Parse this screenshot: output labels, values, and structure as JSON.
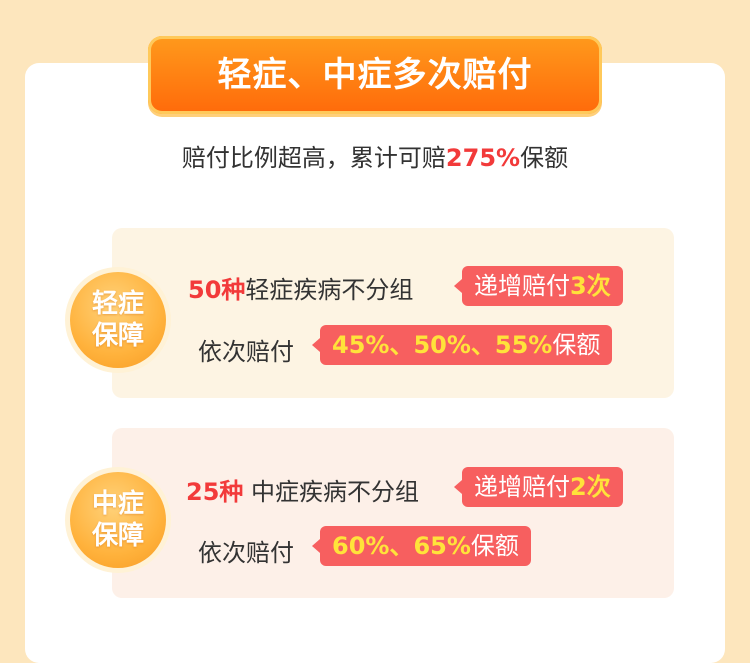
{
  "banner": {
    "title": "轻症、中症多次赔付"
  },
  "subtitle": {
    "prefix": "赔付比例超高，累计可赔",
    "highlight": "275%",
    "suffix": "保额"
  },
  "sections": [
    {
      "badge_line1": "轻症",
      "badge_line2": "保障",
      "count": "50种",
      "desc": "轻症疾病不分组",
      "tag_prefix": "递增赔付",
      "tag_highlight": "3次",
      "line2_label": "依次赔付",
      "rates": "45%、50%、55%",
      "rates_suffix": "保额"
    },
    {
      "badge_line1": "中症",
      "badge_line2": "保障",
      "count": "25种",
      "desc": " 中症疾病不分组",
      "tag_prefix": "递增赔付",
      "tag_highlight": "2次",
      "line2_label": "依次赔付",
      "rates": "60%、65%",
      "rates_suffix": "保额"
    }
  ],
  "colors": {
    "accent": "#f23a3a",
    "tag": "#f75f5f",
    "banner": "#ff7a12",
    "highlight_yellow": "#ffe33a"
  }
}
